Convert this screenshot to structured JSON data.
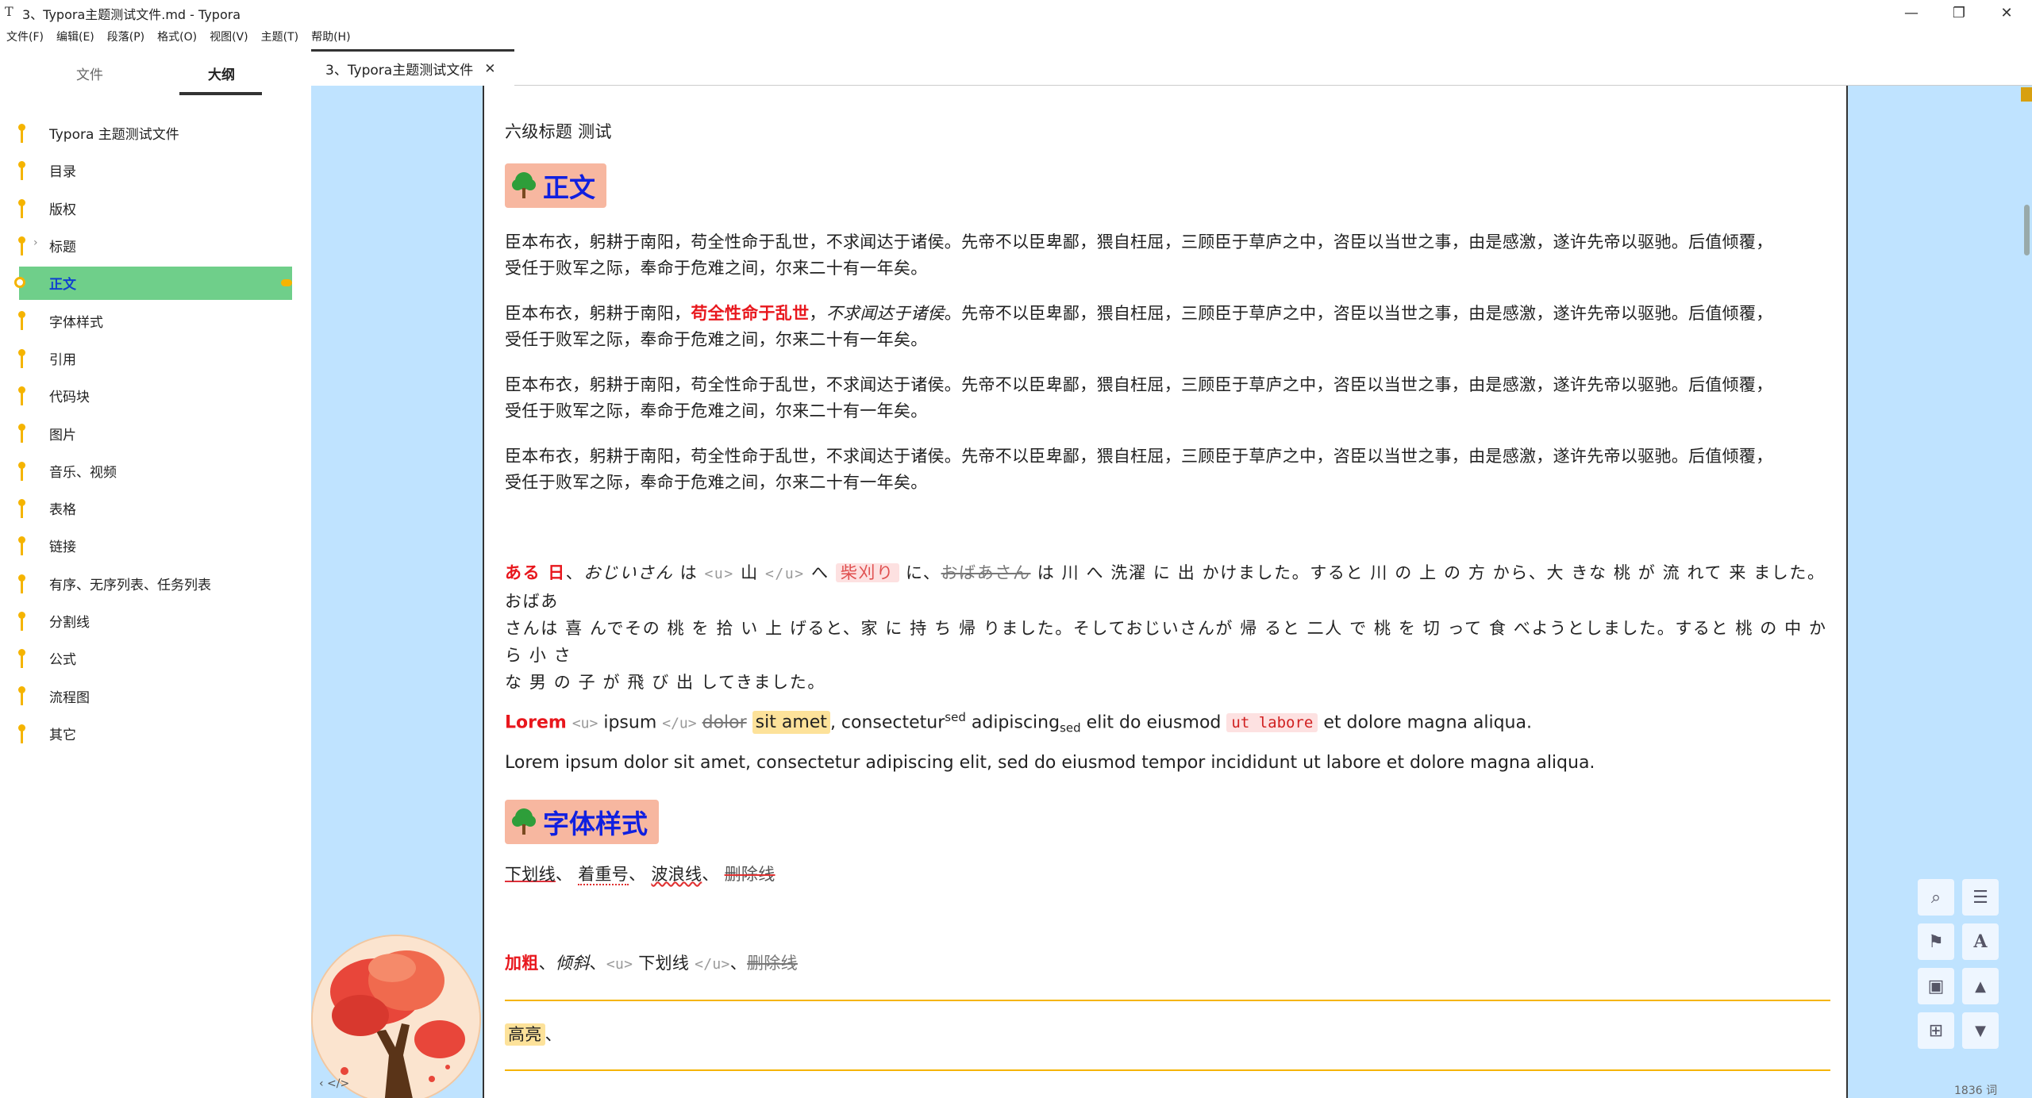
{
  "window": {
    "app_icon_glyph": "T",
    "title": "3、Typora主题测试文件.md - Typora",
    "min_glyph": "—",
    "max_glyph": "❐",
    "close_glyph": "✕"
  },
  "menu": [
    "文件(F)",
    "编辑(E)",
    "段落(P)",
    "格式(O)",
    "视图(V)",
    "主题(T)",
    "帮助(H)"
  ],
  "sidebar": {
    "tab_files": "文件",
    "tab_outline": "大纲",
    "outline": [
      {
        "label": "Typora 主题测试文件",
        "expandable": false,
        "active": false
      },
      {
        "label": "目录",
        "expandable": false,
        "active": false
      },
      {
        "label": "版权",
        "expandable": false,
        "active": false
      },
      {
        "label": "标题",
        "expandable": true,
        "active": false
      },
      {
        "label": "正文",
        "expandable": false,
        "active": true
      },
      {
        "label": "字体样式",
        "expandable": false,
        "active": false
      },
      {
        "label": "引用",
        "expandable": false,
        "active": false
      },
      {
        "label": "代码块",
        "expandable": false,
        "active": false
      },
      {
        "label": "图片",
        "expandable": false,
        "active": false
      },
      {
        "label": "音乐、视频",
        "expandable": false,
        "active": false
      },
      {
        "label": "表格",
        "expandable": false,
        "active": false
      },
      {
        "label": "链接",
        "expandable": false,
        "active": false
      },
      {
        "label": "有序、无序列表、任务列表",
        "expandable": false,
        "active": false
      },
      {
        "label": "分割线",
        "expandable": false,
        "active": false
      },
      {
        "label": "公式",
        "expandable": false,
        "active": false
      },
      {
        "label": "流程图",
        "expandable": false,
        "active": false
      },
      {
        "label": "其它",
        "expandable": false,
        "active": false
      }
    ],
    "chevron_glyph": "›"
  },
  "tab": {
    "label": "3、Typora主题测试文件",
    "close_glyph": "✕"
  },
  "doc": {
    "h6_caption": "六级标题 测试",
    "heading_body": "正文",
    "para_plain": {
      "line1": "臣本布衣，躬耕于南阳，苟全性命于乱世，不求闻达于诸侯。先帝不以臣卑鄙，猥自枉屈，三顾臣于草庐之中，咨臣以当世之事，由是感激，遂许先帝以驱驰。后值倾覆，",
      "line2": "受任于败军之际，奉命于危难之间，尔来二十有一年矣。"
    },
    "para_styled": {
      "pre": "臣本布衣，躬耕于南阳，",
      "bold": "苟全性命于乱世",
      "sep": "，",
      "italic": "不求闻达于诸侯",
      "post": "。先帝不以臣卑鄙，猥自枉屈，三顾臣于草庐之中，咨臣以当世之事，由是感激，遂许先帝以驱驰。后值倾覆，",
      "line2": "受任于败军之际，奉命于危难之间，尔来二十有一年矣。"
    },
    "jp": {
      "bold": "ある 日",
      "c1": "、",
      "italic": "おじいさん",
      "c2": " は ",
      "u_open": "<u>",
      "u_text": " 山 ",
      "u_close": "</u>",
      "c3": " へ ",
      "kbd": "柴刈り",
      "c4": " に、",
      "strike": "おばあさん",
      "c5": " は 川 へ 洗濯 に 出 かけました。すると 川 の 上 の 方 から、大 きな 桃 が 流 れて 来 ました。おばあ",
      "line2": "さんは 喜 んでその 桃 を 拾 い 上 げると、家 に 持 ち 帰 りました。そしておじいさんが 帰 ると 二人 で 桃 を 切 って 食 べようとしました。すると 桃 の 中 から 小 さ",
      "line3": "な 男 の 子 が 飛 び 出 してきました。"
    },
    "lorem_styled": {
      "bold": "Lorem",
      "u_open": "<u>",
      "u_text": " ipsum ",
      "u_close": "</u>",
      "strike": "dolor",
      "hl": "sit amet",
      "c1": ", consectetur",
      "sup": "sed",
      "c2": " adipiscing",
      "sub": "sed",
      "c3": " elit do eiusmod ",
      "code": "ut labore",
      "c4": " et dolore magna aliqua."
    },
    "lorem_plain": "Lorem ipsum dolor sit amet, consectetur adipiscing elit, sed do eiusmod tempor incididunt ut labore et dolore magna aliqua.",
    "heading_font": "字体样式",
    "font_line": {
      "underline": "下划线",
      "s1": "、",
      "dotted": "着重号",
      "s2": "、",
      "wavy": "波浪线",
      "s3": "、",
      "strike": "删除线"
    },
    "html_line": {
      "bold": "加粗",
      "s1": "、",
      "italic": "倾斜",
      "s2": "、",
      "u_open": "<u>",
      "u_text": " 下划线 ",
      "u_close": "</u>",
      "s3": "、",
      "strike": "删除线"
    },
    "hl_line": {
      "hl": "高亮",
      "tail": "、"
    }
  },
  "tools": {
    "search_glyph": "⌕",
    "outline_glyph": "☰",
    "bookmark_glyph": "⚑",
    "font_glyph": "A",
    "image_glyph": "▣",
    "up_glyph": "▲",
    "tree_glyph": "⊞",
    "down_glyph": "▼"
  },
  "status": {
    "word_count": "1836 词",
    "left_icons": "‹   </>"
  },
  "colors": {
    "accent": "#f5b400",
    "active_item": "#6fcf8a",
    "editor_bg": "#bfe3ff",
    "heading_bg": "#f7b7a0",
    "heading_text": "#1020e0"
  }
}
